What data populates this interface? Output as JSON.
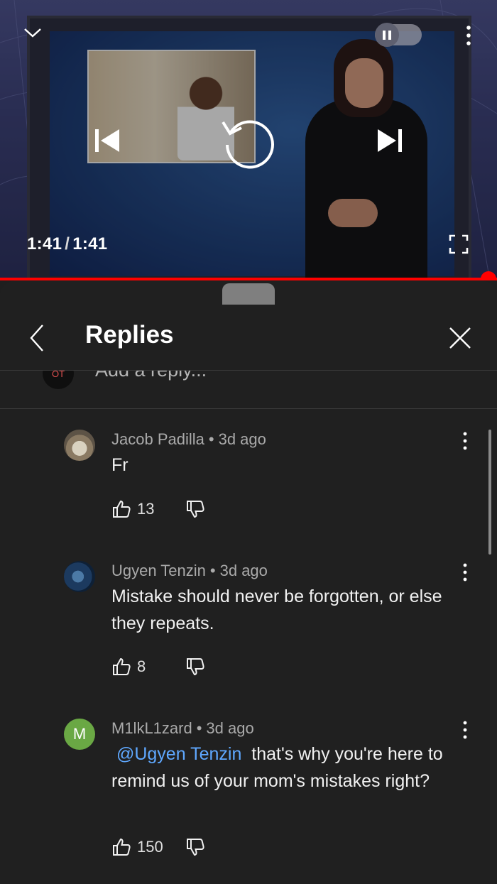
{
  "player": {
    "time_current": "1:41",
    "time_separator": "/",
    "time_total": "1:41",
    "progress": 1.0,
    "accent": "#ff0000"
  },
  "panel": {
    "title": "Replies",
    "add_reply_placeholder": "Add a reply...",
    "my_avatar_text": "OT"
  },
  "comments": [
    {
      "author": "Jacob Padilla",
      "age": "3d ago",
      "text": "Fr",
      "likes": "13"
    },
    {
      "author": "Ugyen Tenzin",
      "age": "3d ago",
      "text": "Mistake should never be forgotten, or else they repeats.",
      "likes": "8"
    },
    {
      "author": "M1lkL1zard",
      "age": "3d ago",
      "avatar_letter": "M",
      "mention": "@Ugyen Tenzin",
      "text": " that's why you're here to remind us of your mom's mistakes right?",
      "likes": "150"
    }
  ],
  "icons": [
    "chevron-down-icon",
    "pause-icon",
    "more-vert-icon",
    "skip-previous-icon",
    "replay-icon",
    "skip-next-icon",
    "fullscreen-icon",
    "back-icon",
    "close-icon",
    "thumb-up-icon",
    "thumb-down-icon"
  ],
  "colors": {
    "panel_bg": "#202020",
    "mention": "#5fa8ff",
    "avatar_m": "#6aa844"
  }
}
